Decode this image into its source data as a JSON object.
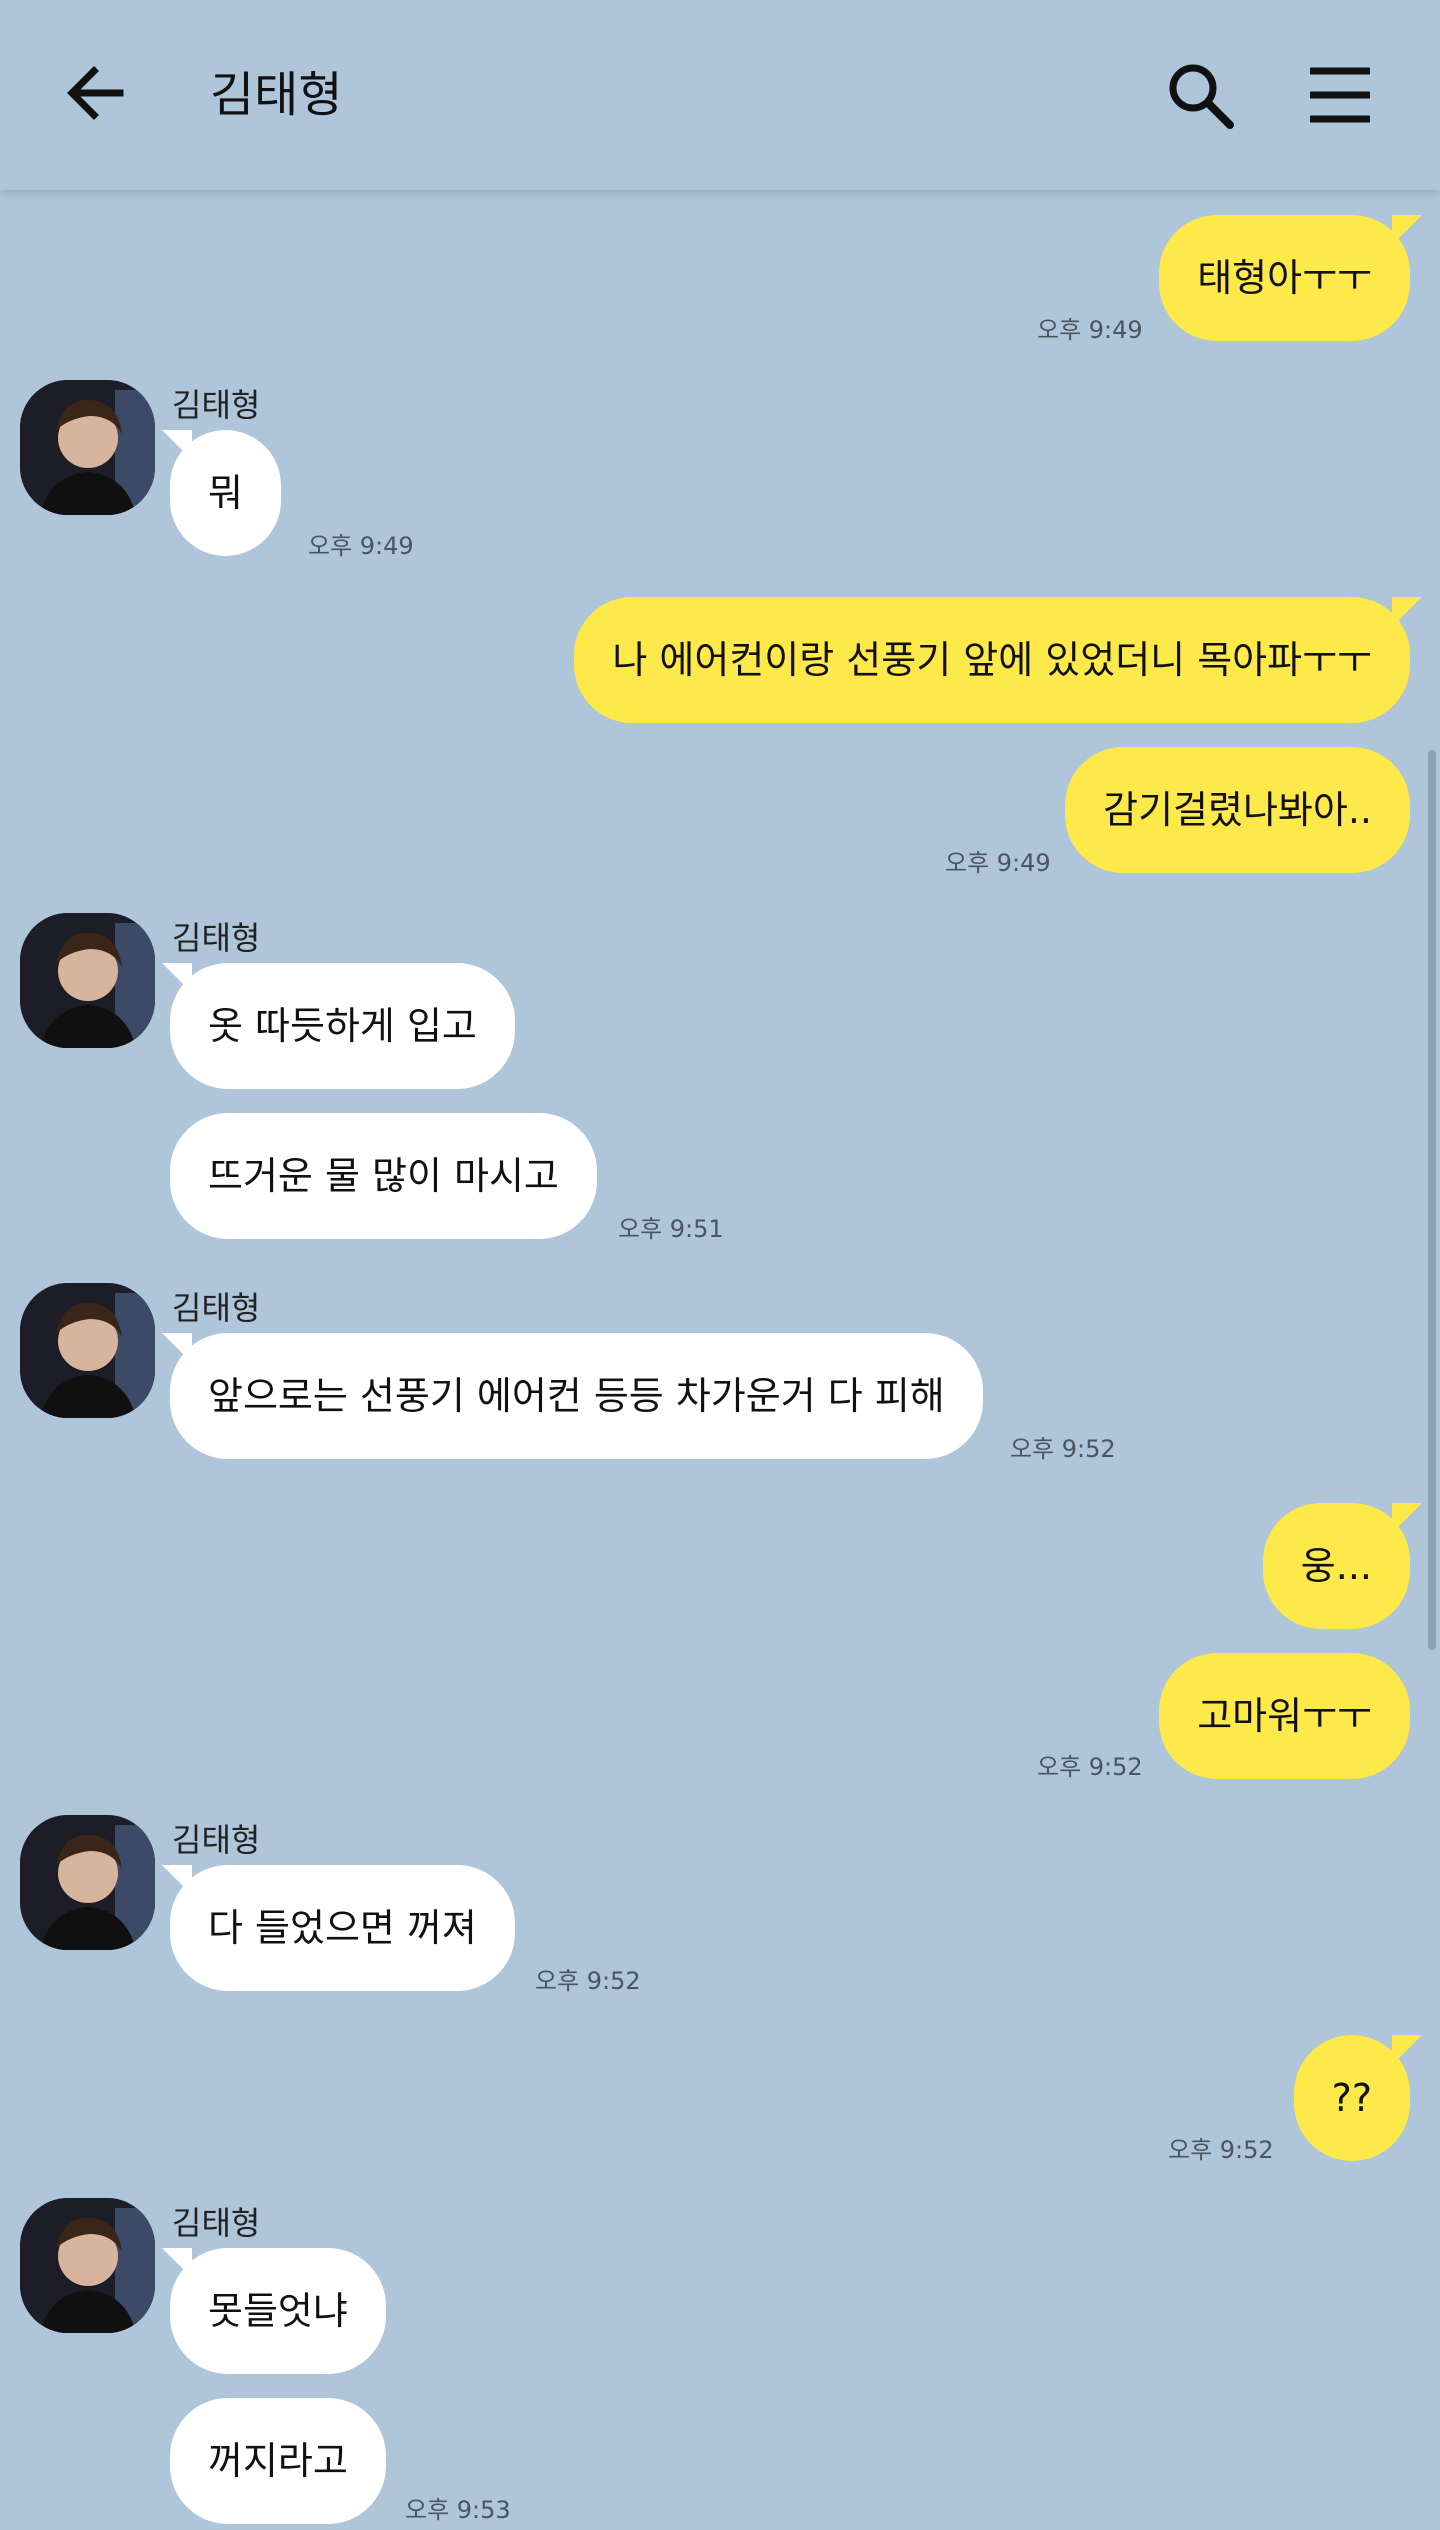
{
  "header": {
    "title": "김태형"
  },
  "messages": [
    {
      "text": "태형아ㅜㅜ",
      "time": "오후 9:49"
    },
    {
      "sender": "김태형",
      "text": "뭐",
      "time": "오후 9:49"
    },
    {
      "text": "나 에어컨이랑 선풍기 앞에 있었더니 목아파ㅜㅜ"
    },
    {
      "text": "감기걸렸나봐아..",
      "time": "오후 9:49"
    },
    {
      "sender": "김태형",
      "text": "옷 따듯하게 입고"
    },
    {
      "text": "뜨거운 물 많이 마시고",
      "time": "오후 9:51"
    },
    {
      "sender": "김태형",
      "text": "앞으로는 선풍기 에어컨 등등 차가운거 다 피해",
      "time": "오후 9:52"
    },
    {
      "text": "웅..."
    },
    {
      "text": "고마워ㅜㅜ",
      "time": "오후 9:52"
    },
    {
      "sender": "김태형",
      "text": "다 들었으면 꺼져",
      "time": "오후 9:52"
    },
    {
      "text": "??",
      "time": "오후 9:52"
    },
    {
      "sender": "김태형",
      "text": "못들엇냐"
    },
    {
      "text": "꺼지라고",
      "time": "오후 9:53"
    }
  ]
}
